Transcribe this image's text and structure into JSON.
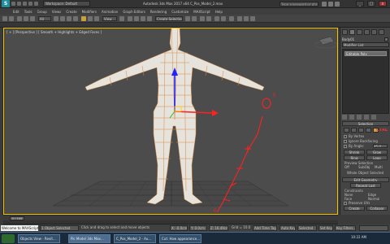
{
  "titlebar": {
    "workspace": "Workspace: Default",
    "title": "Autodesk 3ds Max 2017 x64     C_Pos_Model_2.max",
    "search": "Type a keyword or phrase",
    "min": "_",
    "max": "□",
    "close": "x"
  },
  "menu": [
    "Edit",
    "Tools",
    "Group",
    "Views",
    "Create",
    "Modifiers",
    "Animation",
    "Graph Editors",
    "Rendering",
    "Customize",
    "MAXScript",
    "Help"
  ],
  "toolbar": {
    "selection_filter": "All",
    "view": "View",
    "selection_set": "Create Selection Se"
  },
  "viewport": {
    "label": "[ + ] [Perspective ] [ Smooth + Highlights + Edged Faces ]",
    "annotation_x": "0",
    "annotation_y": "0"
  },
  "command_panel": {
    "object_name": "Body01",
    "modifier_list": "Modifier List",
    "stack_item": "Editable Poly",
    "selection_title": "Selection",
    "by_vertex": "By Vertex",
    "ignore_backfacing": "Ignore Backfacing",
    "by_angle": "By Angle:",
    "angle_value": "45.0",
    "shrink": "Shrink",
    "grow": "Grow",
    "ring": "Ring",
    "loop": "Loop",
    "preview": "Preview Selection",
    "off": "Off",
    "subobj": "SubObj",
    "multi": "Multi",
    "whole": "Whole Object Selected",
    "edit_geometry": "Edit Geometry",
    "repeat_last": "Repeat Last",
    "constraints": "Constraints",
    "none": "None",
    "edge": "Edge",
    "face": "Face",
    "normal": "Normal",
    "preserve_uvs": "Preserve UVs",
    "create": "Create",
    "collapse": "Collapse",
    "attach": "Attach",
    "detach": "Detach",
    "slice_plane": "Slice Plane",
    "split": "Split",
    "slice": "Slice",
    "reset_plane": "Reset Plane",
    "quickslice": "QuickSlice",
    "cut": "Cut",
    "msmooth": "MSmooth",
    "tessellate": "Tessellate",
    "red_note": "CTRL"
  },
  "timebar": {
    "frames": "0 / 100",
    "ticks": [
      "0",
      "5",
      "10",
      "15",
      "20",
      "25",
      "30",
      "35",
      "40",
      "45",
      "50",
      "55",
      "60",
      "65",
      "70",
      "75",
      "80",
      "85",
      "90",
      "95",
      "100"
    ]
  },
  "status": {
    "maxscript": "Welcome to MAXScript.",
    "objects": "1 Object Selected",
    "prompt": "Click and drag to select and move objects",
    "x": "X: -0.0cm",
    "y": "Y: 0.0cm",
    "z": "Z: 16.49cm",
    "grid": "Grid = 10.0cm",
    "add_time_tag": "Add Time Tag",
    "autokey": "Auto Key",
    "selected": "Selected",
    "setkey": "Set Key",
    "key_filters": "Key Filters..."
  },
  "taskbar": {
    "tasks": [
      "Objects View - Revit...",
      "Pic Model 3ds Max...",
      "C_Pos_Model_2 - Au...",
      "Cut: How appearance..."
    ],
    "clock": "10:22 AM"
  }
}
